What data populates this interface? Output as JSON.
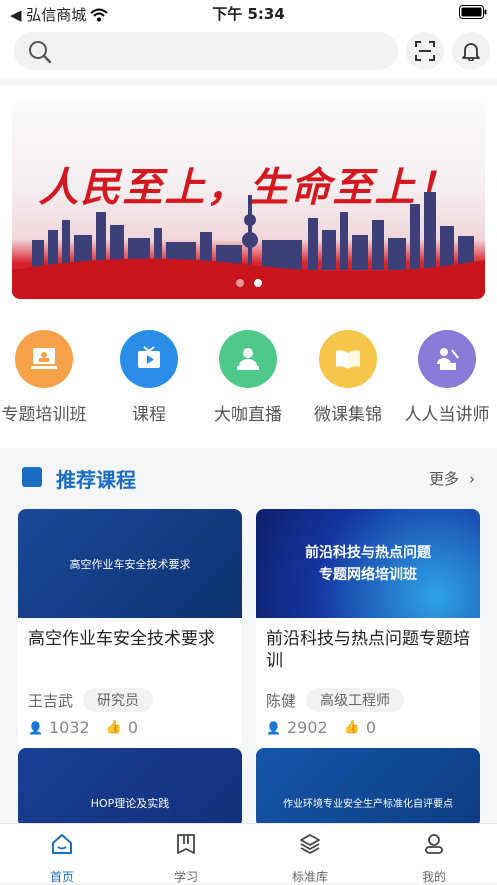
{
  "status": {
    "carrier": "◀ 弘信商城",
    "time": "下午 5:34"
  },
  "search": {
    "placeholder": ""
  },
  "banner": {
    "slogan": "人民至上，生命至上！"
  },
  "entries": [
    {
      "label": "专题培训班",
      "color": "#f5a24a"
    },
    {
      "label": "课程",
      "color": "#2a8ee8"
    },
    {
      "label": "大咖直播",
      "color": "#4fc98a"
    },
    {
      "label": "微课集锦",
      "color": "#f6c64a"
    },
    {
      "label": "人人当讲师",
      "color": "#8b7ad8"
    }
  ],
  "recommend": {
    "title": "推荐课程",
    "more": "更多",
    "courses": [
      {
        "thumb_text": "高空作业车安全技术要求",
        "title": "高空作业车安全技术要求",
        "author": "王吉武",
        "role": "研究员",
        "views": "1032",
        "likes": "0"
      },
      {
        "thumb_text": "前沿科技与热点问题\n专题网络培训班",
        "title": "前沿科技与热点问题专题培训",
        "author": "陈健",
        "role": "高级工程师",
        "views": "2902",
        "likes": "0"
      },
      {
        "thumb_text": "HOP理论及实践",
        "title": "",
        "author": "",
        "role": "",
        "views": "",
        "likes": ""
      },
      {
        "thumb_text": "作业环境专业安全生产标准化自评要点",
        "title": "",
        "author": "",
        "role": "",
        "views": "",
        "likes": ""
      }
    ]
  },
  "tabs": [
    {
      "label": "首页",
      "icon": "home-icon",
      "active": true
    },
    {
      "label": "学习",
      "icon": "book-icon",
      "active": false
    },
    {
      "label": "标准库",
      "icon": "layers-icon",
      "active": false
    },
    {
      "label": "我的",
      "icon": "user-icon",
      "active": false
    }
  ],
  "colors": {
    "accent": "#1b6dc4",
    "banner_red": "#d5181f"
  }
}
